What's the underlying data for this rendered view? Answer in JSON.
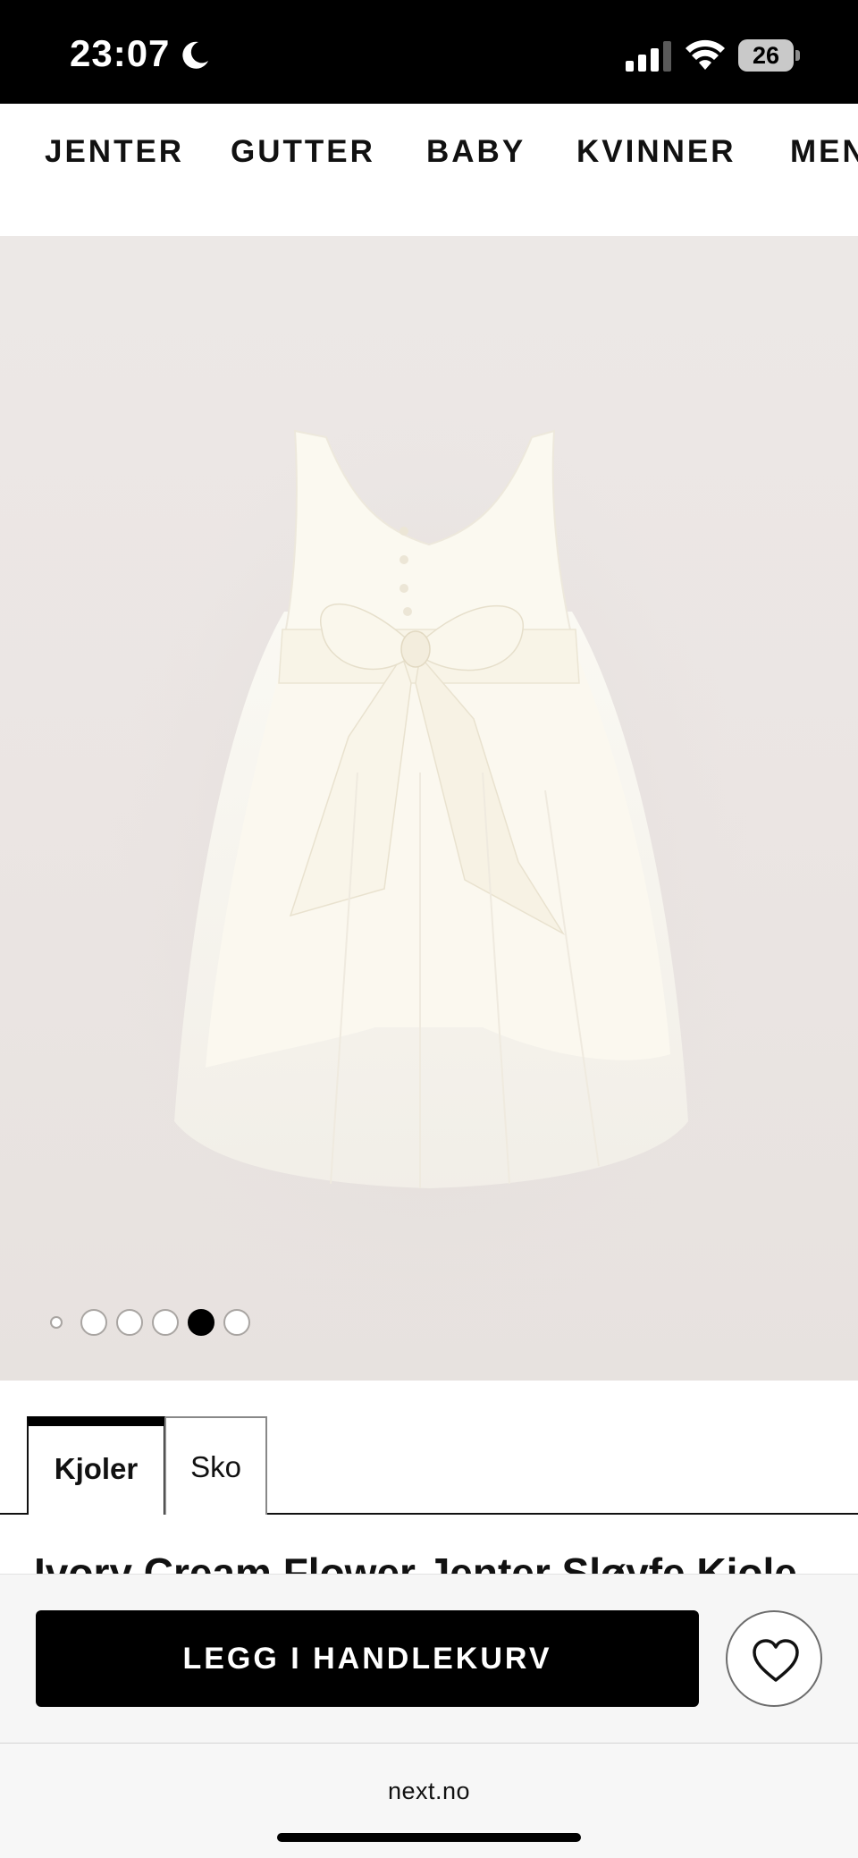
{
  "status_bar": {
    "time": "23:07",
    "battery": "26",
    "icons": [
      "moon-icon",
      "signal-icon",
      "wifi-icon",
      "battery-icon"
    ]
  },
  "category_nav": {
    "items": [
      {
        "label": "JENTER"
      },
      {
        "label": "GUTTER"
      },
      {
        "label": "BABY"
      },
      {
        "label": "KVINNER"
      },
      {
        "label": "MEN"
      }
    ]
  },
  "product_image": {
    "dot_count": 6,
    "active_dot": 5
  },
  "tabs": [
    {
      "label": "Kjoler",
      "active": true
    },
    {
      "label": "Sko",
      "active": false
    }
  ],
  "product_title_peek": "Ivory Cream Flower Jenter Sløyfe Kjole",
  "cart_bar": {
    "add_to_cart_label": "LEGG I HANDLEKURV",
    "wishlist_icon": "heart-icon"
  },
  "browser": {
    "domain": "next.no"
  },
  "colors": {
    "primary": "#000000",
    "background": "#ffffff",
    "image_bg": "#ebe6e4",
    "dress": "#fbf9f1"
  }
}
